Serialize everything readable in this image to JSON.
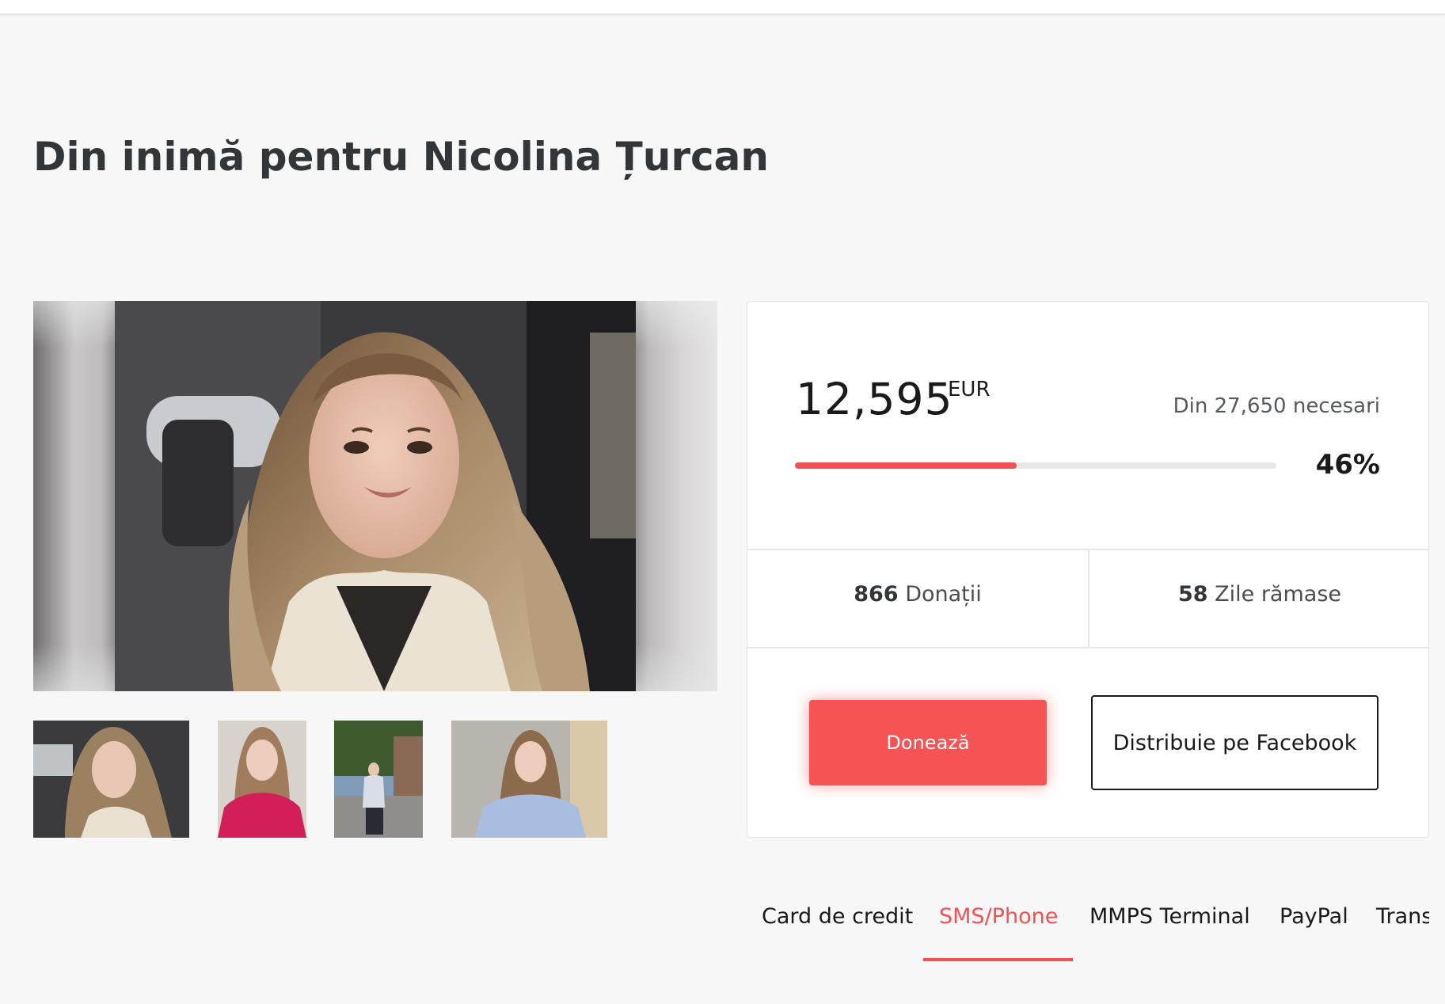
{
  "page": {
    "title": "Din inimă pentru Nicolina Țurcan"
  },
  "gallery": {
    "main_photo_alt": "Nicolina Țurcan",
    "thumbnails": [
      {
        "name": "thumbnail-1"
      },
      {
        "name": "thumbnail-2"
      },
      {
        "name": "thumbnail-3"
      },
      {
        "name": "thumbnail-4"
      }
    ]
  },
  "campaign": {
    "raised": "12,595",
    "currency": "EUR",
    "goal_text": "Din 27,650 necesari",
    "progress_percent": 46,
    "percent_label": "46%",
    "donations_count": "866",
    "donations_label": "Donații",
    "days_left": "58",
    "days_left_label": "Zile rămase",
    "donate_label": "Donează",
    "share_label": "Distribuie pe Facebook"
  },
  "payment_tabs": {
    "items": [
      {
        "label": "Card de credit",
        "active": false
      },
      {
        "label": "SMS/Phone",
        "active": true
      },
      {
        "label": "MMPS Terminal",
        "active": false
      },
      {
        "label": "PayPal",
        "active": false
      },
      {
        "label": "Trans",
        "active": false
      }
    ]
  },
  "colors": {
    "accent": "#f45052",
    "background": "#f7f7f7",
    "text": "#333638"
  }
}
